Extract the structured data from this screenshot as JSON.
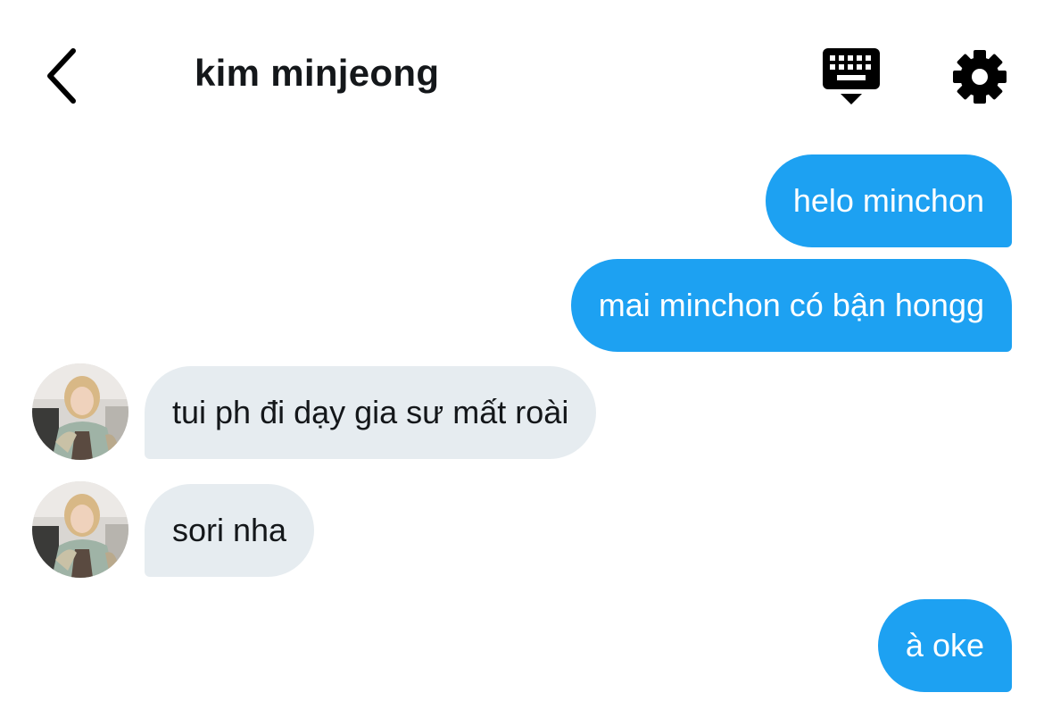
{
  "header": {
    "back_icon": "chevron-left-icon",
    "title": "kim minjeong",
    "keyboard_icon": "keyboard-icon",
    "settings_icon": "gear-icon"
  },
  "colors": {
    "outgoing_bubble": "#1da1f2",
    "incoming_bubble": "#e6ecf0",
    "text_dark": "#14171a",
    "text_light": "#ffffff"
  },
  "messages": [
    {
      "direction": "outgoing",
      "text": "helo minchon"
    },
    {
      "direction": "outgoing",
      "text": "mai minchon có bận hongg"
    },
    {
      "direction": "incoming",
      "text": "tui ph đi dạy gia sư mất roài"
    },
    {
      "direction": "incoming",
      "text": "sori nha"
    },
    {
      "direction": "outgoing",
      "text": "à oke"
    }
  ]
}
